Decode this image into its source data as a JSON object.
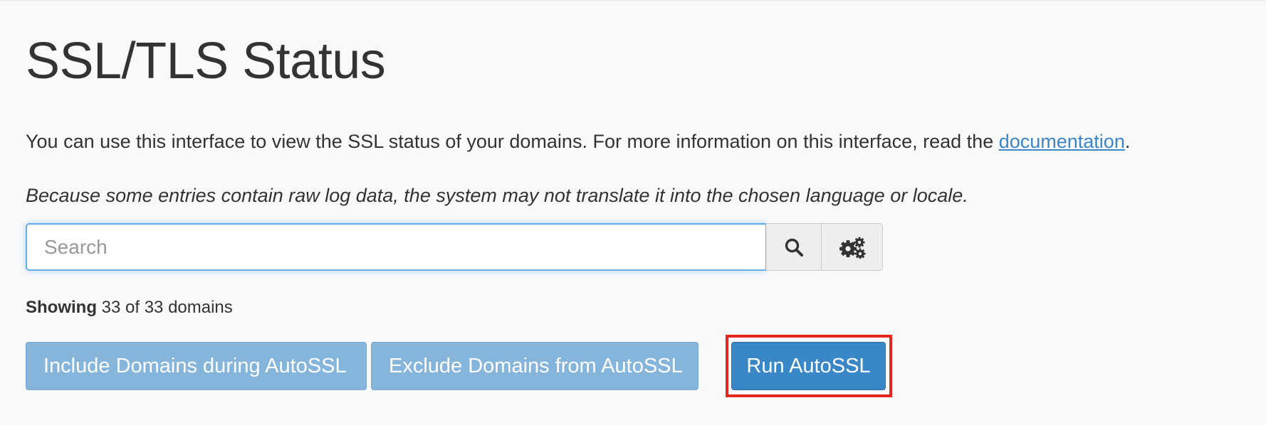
{
  "page": {
    "title": "SSL/TLS Status",
    "description_prefix": "You can use this interface to view the SSL status of your domains. For more information on this interface, read the ",
    "description_link": "documentation",
    "description_suffix": ".",
    "note": "Because some entries contain raw log data, the system may not translate it into the chosen language or locale."
  },
  "search": {
    "placeholder": "Search",
    "value": "",
    "search_icon": "search-icon",
    "settings_icon": "gears-icon"
  },
  "status": {
    "label": "Showing",
    "text": " 33 of 33 domains"
  },
  "actions": {
    "include_label": "Include Domains during AutoSSL",
    "exclude_label": "Exclude Domains from AutoSSL",
    "run_label": "Run AutoSSL"
  },
  "colors": {
    "primary": "#3a87c8",
    "primary_light": "#86b5db",
    "link": "#3a87c8",
    "highlight": "#e5261f"
  }
}
